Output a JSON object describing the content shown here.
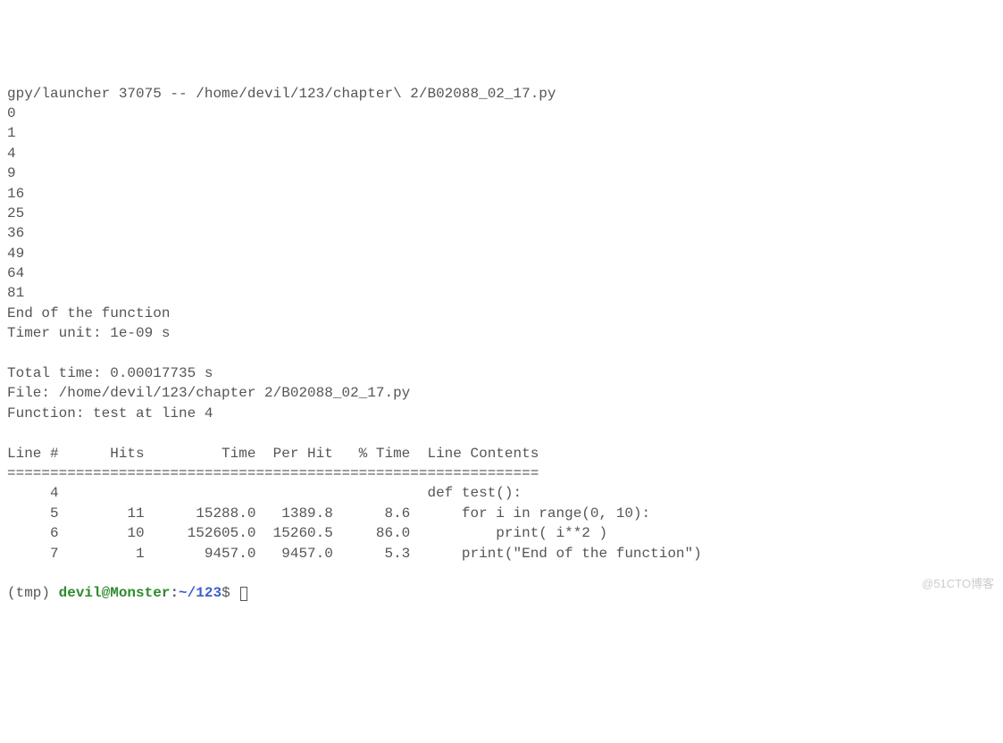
{
  "header_line": "gpy/launcher 37075 -- /home/devil/123/chapter\\ 2/B02088_02_17.py",
  "output_numbers": [
    "0",
    "1",
    "4",
    "9",
    "16",
    "25",
    "36",
    "49",
    "64",
    "81"
  ],
  "end_msg": "End of the function",
  "timer_unit": "Timer unit: 1e-09 s",
  "total_time": "Total time: 0.00017735 s",
  "file_line": "File: /home/devil/123/chapter 2/B02088_02_17.py",
  "function_line": "Function: test at line 4",
  "table_header": "Line #      Hits         Time  Per Hit   % Time  Line Contents",
  "table_divider": "==============================================================",
  "table_rows": [
    "     4                                           def test():",
    "     5        11      15288.0   1389.8      8.6      for i in range(0, 10):",
    "     6        10     152605.0  15260.5     86.0          print( i**2 )",
    "     7         1       9457.0   9457.0      5.3      print(\"End of the function\")"
  ],
  "prompt": {
    "env": "(tmp) ",
    "user_host": "devil@Monster",
    "colon": ":",
    "path": "~/123",
    "dollar": "$ "
  },
  "watermark": "@51CTO博客"
}
